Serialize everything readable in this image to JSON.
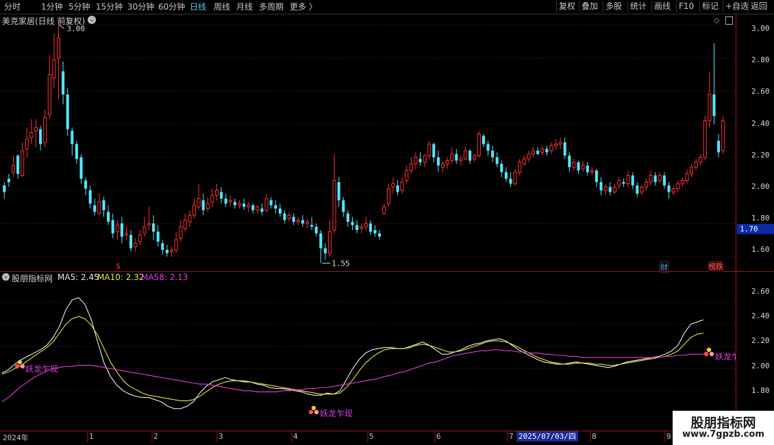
{
  "toolbar": {
    "periods": [
      "分时",
      "1分钟",
      "5分钟",
      "15分钟",
      "30分钟",
      "60分钟",
      "日线",
      "周线",
      "月线",
      "多周期",
      "更多 〉"
    ],
    "active_period": "日线",
    "tools": [
      "复权",
      "叠加",
      "多股",
      "统计",
      "画线",
      "F10",
      "标记",
      "+自选",
      "返回"
    ]
  },
  "main_chart": {
    "title": "美克家居(日线 前复权)",
    "high_label": "3.00",
    "low_label": "1.55",
    "current_price": "1.70",
    "y_ticks": [
      "3.00",
      "2.80",
      "2.60",
      "2.40",
      "2.20",
      "2.00",
      "1.80",
      "1.60"
    ],
    "event_marks": {
      "split": "$",
      "finance": "财",
      "rank": "榜跌"
    }
  },
  "indicator": {
    "name": "股朋指标网",
    "ma5_label": "MA5: 2.45",
    "ma10_label": "MA10: 2.32",
    "ma58_label": "MA58: 2.13",
    "signal_label": "妖龙乍现",
    "signal_label_cut": "妖龙乍",
    "y_ticks": [
      "2.60",
      "2.40",
      "2.20",
      "2.00",
      "1.80"
    ]
  },
  "x_axis": {
    "labels": [
      "2024年",
      "1",
      "2",
      "3",
      "4",
      "5",
      "6",
      "7",
      "8",
      "9"
    ],
    "cursor_date": "2025/07/03/四"
  },
  "watermark": {
    "name": "股朋指标网",
    "url": "www.7gpzb.com"
  },
  "chart_data": {
    "type": "candlestick",
    "title": "美克家居(日线 前复权)",
    "ylim": [
      1.52,
      3.06
    ],
    "y_ticks": [
      3.0,
      2.8,
      2.6,
      2.4,
      2.2,
      2.0,
      1.8,
      1.6
    ],
    "annotations": {
      "high": 3.0,
      "low": 1.55,
      "current": 1.7
    },
    "candles": [
      [
        2.03,
        2.05,
        1.99,
        1.95
      ],
      [
        2.07,
        2.1,
        2.05,
        2.02
      ],
      [
        2.11,
        2.21,
        2.15,
        2.08
      ],
      [
        2.21,
        2.22,
        2.1,
        2.07
      ],
      [
        2.09,
        2.29,
        2.24,
        2.08
      ],
      [
        2.25,
        2.38,
        2.31,
        2.2
      ],
      [
        2.32,
        2.43,
        2.35,
        2.28
      ],
      [
        2.36,
        2.43,
        2.38,
        2.26
      ],
      [
        2.37,
        2.39,
        2.28,
        2.24
      ],
      [
        2.29,
        2.49,
        2.44,
        2.26
      ],
      [
        2.46,
        2.82,
        2.7,
        2.43
      ],
      [
        2.68,
        2.95,
        2.79,
        2.62
      ],
      [
        2.8,
        3.0,
        2.92,
        2.55
      ],
      [
        2.72,
        2.78,
        2.58,
        2.52
      ],
      [
        2.58,
        2.62,
        2.37,
        2.33
      ],
      [
        2.36,
        2.38,
        2.28,
        2.21
      ],
      [
        2.28,
        2.3,
        2.19,
        2.16
      ],
      [
        2.2,
        2.22,
        2.07,
        2.04
      ],
      [
        2.06,
        2.08,
        2.01,
        1.97
      ],
      [
        2.0,
        2.03,
        1.92,
        1.89
      ],
      [
        1.91,
        1.95,
        1.87,
        1.85
      ],
      [
        1.86,
        1.98,
        1.93,
        1.85
      ],
      [
        1.94,
        1.96,
        1.88,
        1.84
      ],
      [
        1.87,
        1.91,
        1.81,
        1.79
      ],
      [
        1.82,
        1.86,
        1.74,
        1.71
      ],
      [
        1.75,
        1.82,
        1.79,
        1.7
      ],
      [
        1.8,
        1.84,
        1.72,
        1.68
      ],
      [
        1.73,
        1.78,
        1.74,
        1.7
      ],
      [
        1.73,
        1.76,
        1.65,
        1.63
      ],
      [
        1.66,
        1.71,
        1.68,
        1.63
      ],
      [
        1.69,
        1.76,
        1.73,
        1.67
      ],
      [
        1.74,
        1.84,
        1.78,
        1.72
      ],
      [
        1.79,
        1.9,
        1.8,
        1.76
      ],
      [
        1.8,
        1.85,
        1.75,
        1.7
      ],
      [
        1.75,
        1.79,
        1.69,
        1.66
      ],
      [
        1.68,
        1.7,
        1.64,
        1.61
      ],
      [
        1.64,
        1.67,
        1.62,
        1.6
      ],
      [
        1.63,
        1.66,
        1.64,
        1.6
      ],
      [
        1.64,
        1.75,
        1.7,
        1.62
      ],
      [
        1.71,
        1.82,
        1.78,
        1.69
      ],
      [
        1.77,
        1.86,
        1.82,
        1.75
      ],
      [
        1.81,
        1.88,
        1.85,
        1.78
      ],
      [
        1.85,
        1.95,
        1.91,
        1.83
      ],
      [
        1.9,
        2.04,
        1.95,
        1.88
      ],
      [
        1.94,
        1.98,
        1.88,
        1.85
      ],
      [
        1.89,
        1.96,
        1.92,
        1.87
      ],
      [
        1.93,
        2.01,
        1.97,
        1.9
      ],
      [
        1.97,
        2.04,
        2.0,
        1.94
      ],
      [
        1.99,
        2.02,
        1.95,
        1.92
      ],
      [
        1.95,
        1.98,
        1.92,
        1.9
      ],
      [
        1.93,
        1.97,
        1.94,
        1.9
      ],
      [
        1.93,
        1.95,
        1.91,
        1.89
      ],
      [
        1.91,
        1.94,
        1.92,
        1.89
      ],
      [
        1.92,
        1.95,
        1.9,
        1.88
      ],
      [
        1.9,
        1.93,
        1.91,
        1.87
      ],
      [
        1.91,
        1.92,
        1.88,
        1.86
      ],
      [
        1.88,
        1.91,
        1.9,
        1.86
      ],
      [
        1.89,
        1.92,
        1.87,
        1.85
      ],
      [
        1.88,
        1.98,
        1.95,
        1.87
      ],
      [
        1.94,
        1.96,
        1.91,
        1.89
      ],
      [
        1.91,
        1.94,
        1.89,
        1.86
      ],
      [
        1.89,
        1.92,
        1.86,
        1.84
      ],
      [
        1.86,
        1.88,
        1.82,
        1.8
      ],
      [
        1.83,
        1.87,
        1.85,
        1.81
      ],
      [
        1.84,
        1.86,
        1.81,
        1.79
      ],
      [
        1.81,
        1.84,
        1.82,
        1.79
      ],
      [
        1.82,
        1.85,
        1.8,
        1.78
      ],
      [
        1.8,
        1.83,
        1.81,
        1.77
      ],
      [
        1.79,
        1.84,
        1.78,
        1.76
      ],
      [
        1.78,
        1.8,
        1.74,
        1.72
      ],
      [
        1.74,
        1.76,
        1.65,
        1.56
      ],
      [
        1.65,
        1.68,
        1.62,
        1.58
      ],
      [
        1.62,
        1.82,
        1.75,
        1.6
      ],
      [
        1.76,
        2.22,
        2.06,
        1.74
      ],
      [
        2.05,
        2.08,
        1.94,
        1.9
      ],
      [
        1.94,
        1.96,
        1.87,
        1.84
      ],
      [
        1.86,
        1.88,
        1.81,
        1.78
      ],
      [
        1.81,
        1.84,
        1.79,
        1.76
      ],
      [
        1.79,
        1.82,
        1.76,
        1.74
      ],
      [
        1.77,
        1.8,
        1.78,
        1.74
      ],
      [
        1.78,
        1.84,
        1.8,
        1.76
      ],
      [
        1.8,
        1.82,
        1.75,
        1.73
      ],
      [
        1.76,
        1.79,
        1.74,
        1.72
      ],
      [
        1.74,
        1.76,
        1.72,
        1.7
      ],
      [
        1.86,
        1.92,
        1.9,
        1.85
      ],
      [
        1.92,
        2.04,
        2.01,
        1.9
      ],
      [
        2.02,
        2.08,
        2.04,
        1.98
      ],
      [
        2.03,
        2.06,
        1.99,
        1.97
      ],
      [
        2.0,
        2.08,
        2.05,
        1.98
      ],
      [
        2.06,
        2.15,
        2.12,
        2.04
      ],
      [
        2.12,
        2.2,
        2.16,
        2.1
      ],
      [
        2.16,
        2.23,
        2.2,
        2.13
      ],
      [
        2.19,
        2.23,
        2.17,
        2.15
      ],
      [
        2.17,
        2.22,
        2.21,
        2.14
      ],
      [
        2.21,
        2.3,
        2.28,
        2.19
      ],
      [
        2.28,
        2.29,
        2.2,
        2.17
      ],
      [
        2.2,
        2.24,
        2.15,
        2.11
      ],
      [
        2.14,
        2.18,
        2.16,
        2.11
      ],
      [
        2.16,
        2.2,
        2.18,
        2.13
      ],
      [
        2.18,
        2.26,
        2.22,
        2.16
      ],
      [
        2.22,
        2.25,
        2.18,
        2.16
      ],
      [
        2.18,
        2.21,
        2.19,
        2.15
      ],
      [
        2.19,
        2.26,
        2.24,
        2.18
      ],
      [
        2.24,
        2.25,
        2.18,
        2.16
      ],
      [
        2.19,
        2.22,
        2.21,
        2.17
      ],
      [
        2.21,
        2.36,
        2.34,
        2.2
      ],
      [
        2.33,
        2.34,
        2.28,
        2.26
      ],
      [
        2.28,
        2.3,
        2.24,
        2.21
      ],
      [
        2.24,
        2.27,
        2.2,
        2.17
      ],
      [
        2.2,
        2.23,
        2.16,
        2.14
      ],
      [
        2.16,
        2.18,
        2.11,
        2.08
      ],
      [
        2.11,
        2.14,
        2.07,
        2.05
      ],
      [
        2.07,
        2.11,
        2.04,
        2.02
      ],
      [
        2.04,
        2.13,
        2.11,
        2.03
      ],
      [
        2.11,
        2.19,
        2.17,
        2.09
      ],
      [
        2.16,
        2.21,
        2.19,
        2.15
      ],
      [
        2.19,
        2.24,
        2.22,
        2.17
      ],
      [
        2.22,
        2.26,
        2.24,
        2.2
      ],
      [
        2.24,
        2.26,
        2.22,
        2.21
      ],
      [
        2.23,
        2.27,
        2.25,
        2.21
      ],
      [
        2.25,
        2.27,
        2.23,
        2.21
      ],
      [
        2.24,
        2.29,
        2.27,
        2.22
      ],
      [
        2.27,
        2.31,
        2.28,
        2.25
      ],
      [
        2.28,
        2.32,
        2.29,
        2.25
      ],
      [
        2.29,
        2.32,
        2.21,
        2.19
      ],
      [
        2.21,
        2.23,
        2.14,
        2.11
      ],
      [
        2.14,
        2.19,
        2.17,
        2.12
      ],
      [
        2.17,
        2.18,
        2.12,
        2.1
      ],
      [
        2.13,
        2.18,
        2.15,
        2.11
      ],
      [
        2.15,
        2.17,
        2.11,
        2.09
      ],
      [
        2.11,
        2.14,
        2.12,
        2.09
      ],
      [
        2.12,
        2.13,
        2.05,
        2.02
      ],
      [
        2.05,
        2.08,
        2.0,
        1.97
      ],
      [
        2.0,
        2.04,
        2.02,
        1.97
      ],
      [
        2.02,
        2.05,
        1.99,
        1.97
      ],
      [
        1.99,
        2.04,
        2.02,
        1.98
      ],
      [
        2.03,
        2.08,
        2.06,
        2.01
      ],
      [
        2.05,
        2.07,
        2.04,
        2.02
      ],
      [
        2.04,
        2.12,
        2.09,
        2.02
      ],
      [
        2.09,
        2.11,
        2.03,
        2.01
      ],
      [
        2.03,
        2.05,
        1.98,
        1.96
      ],
      [
        1.99,
        2.03,
        2.02,
        1.97
      ],
      [
        2.02,
        2.07,
        2.05,
        2.0
      ],
      [
        2.05,
        2.12,
        2.09,
        2.03
      ],
      [
        2.09,
        2.11,
        2.05,
        2.03
      ],
      [
        2.06,
        2.11,
        2.09,
        2.04
      ],
      [
        2.09,
        2.11,
        2.03,
        2.01
      ],
      [
        2.03,
        2.05,
        1.99,
        1.95
      ],
      [
        1.99,
        2.03,
        2.01,
        1.97
      ],
      [
        2.01,
        2.06,
        2.04,
        1.99
      ],
      [
        2.04,
        2.08,
        2.06,
        2.02
      ],
      [
        2.06,
        2.13,
        2.1,
        2.04
      ],
      [
        2.1,
        2.16,
        2.14,
        2.08
      ],
      [
        2.14,
        2.19,
        2.17,
        2.12
      ],
      [
        2.17,
        2.22,
        2.2,
        2.15
      ],
      [
        2.2,
        2.45,
        2.42,
        2.18
      ],
      [
        2.42,
        2.72,
        2.58,
        2.38
      ],
      [
        2.58,
        2.89,
        2.45,
        2.4
      ],
      [
        2.3,
        2.34,
        2.23,
        2.2
      ],
      [
        2.24,
        2.45,
        2.42,
        2.22
      ]
    ],
    "indicator": {
      "ylim": [
        1.62,
        2.78
      ],
      "y_ticks": [
        2.6,
        2.4,
        2.2,
        2.0,
        1.8
      ],
      "series": [
        {
          "name": "MA5",
          "color": "#f0f0f0",
          "values": [
            1.96,
            1.99,
            2.04,
            2.08,
            2.11,
            2.14,
            2.17,
            2.21,
            2.28,
            2.38,
            2.53,
            2.62,
            2.64,
            2.58,
            2.44,
            2.24,
            2.05,
            1.93,
            1.85,
            1.8,
            1.77,
            1.75,
            1.74,
            1.74,
            1.72,
            1.7,
            1.66,
            1.64,
            1.64,
            1.66,
            1.7,
            1.78,
            1.84,
            1.88,
            1.9,
            1.92,
            1.9,
            1.89,
            1.88,
            1.88,
            1.86,
            1.85,
            1.83,
            1.82,
            1.82,
            1.81,
            1.8,
            1.79,
            1.77,
            1.76,
            1.76,
            1.78,
            1.77,
            1.8,
            1.9,
            2.0,
            2.08,
            2.14,
            2.17,
            2.18,
            2.19,
            2.19,
            2.18,
            2.18,
            2.2,
            2.22,
            2.24,
            2.21,
            2.17,
            2.13,
            2.13,
            2.15,
            2.17,
            2.2,
            2.22,
            2.23,
            2.25,
            2.26,
            2.27,
            2.25,
            2.21,
            2.17,
            2.14,
            2.11,
            2.08,
            2.06,
            2.05,
            2.04,
            2.04,
            2.05,
            2.06,
            2.05,
            2.04,
            2.03,
            2.02,
            2.01,
            2.02,
            2.04,
            2.06,
            2.07,
            2.08,
            2.09,
            2.1,
            2.11,
            2.13,
            2.16,
            2.21,
            2.32,
            2.4,
            2.42,
            2.44
          ]
        },
        {
          "name": "MA10",
          "color": "#e8e840",
          "values": [
            1.95,
            1.97,
            2.0,
            2.03,
            2.07,
            2.11,
            2.15,
            2.19,
            2.24,
            2.32,
            2.4,
            2.45,
            2.47,
            2.45,
            2.39,
            2.3,
            2.18,
            2.06,
            1.97,
            1.89,
            1.84,
            1.81,
            1.78,
            1.76,
            1.75,
            1.74,
            1.73,
            1.72,
            1.71,
            1.71,
            1.72,
            1.75,
            1.79,
            1.83,
            1.86,
            1.88,
            1.89,
            1.89,
            1.89,
            1.88,
            1.87,
            1.86,
            1.85,
            1.84,
            1.83,
            1.82,
            1.81,
            1.8,
            1.79,
            1.78,
            1.77,
            1.77,
            1.77,
            1.78,
            1.83,
            1.9,
            1.98,
            2.05,
            2.1,
            2.14,
            2.17,
            2.18,
            2.18,
            2.18,
            2.19,
            2.21,
            2.22,
            2.21,
            2.19,
            2.17,
            2.15,
            2.15,
            2.16,
            2.18,
            2.2,
            2.22,
            2.24,
            2.25,
            2.25,
            2.24,
            2.22,
            2.19,
            2.16,
            2.13,
            2.1,
            2.08,
            2.06,
            2.05,
            2.04,
            2.04,
            2.05,
            2.05,
            2.05,
            2.04,
            2.04,
            2.03,
            2.03,
            2.04,
            2.05,
            2.06,
            2.07,
            2.08,
            2.09,
            2.1,
            2.11,
            2.13,
            2.16,
            2.22,
            2.28,
            2.31,
            2.32
          ]
        },
        {
          "name": "MA58",
          "color": "#e040e0",
          "values": [
            1.7,
            1.74,
            1.79,
            1.84,
            1.88,
            1.92,
            1.95,
            1.98,
            2.0,
            2.01,
            2.02,
            2.02,
            2.03,
            2.03,
            2.03,
            2.02,
            2.01,
            2.0,
            1.99,
            1.98,
            1.97,
            1.96,
            1.95,
            1.94,
            1.93,
            1.92,
            1.91,
            1.9,
            1.89,
            1.88,
            1.87,
            1.86,
            1.86,
            1.85,
            1.84,
            1.83,
            1.82,
            1.81,
            1.8,
            1.8,
            1.79,
            1.79,
            1.79,
            1.79,
            1.8,
            1.8,
            1.81,
            1.81,
            1.82,
            1.82,
            1.83,
            1.83,
            1.84,
            1.85,
            1.86,
            1.87,
            1.88,
            1.89,
            1.9,
            1.91,
            1.93,
            1.94,
            1.96,
            1.97,
            1.99,
            2.01,
            2.03,
            2.05,
            2.06,
            2.08,
            2.1,
            2.12,
            2.13,
            2.14,
            2.15,
            2.16,
            2.16,
            2.17,
            2.17,
            2.16,
            2.16,
            2.15,
            2.15,
            2.14,
            2.14,
            2.13,
            2.13,
            2.12,
            2.12,
            2.11,
            2.11,
            2.1,
            2.1,
            2.1,
            2.1,
            2.1,
            2.1,
            2.1,
            2.1,
            2.1,
            2.1,
            2.1,
            2.1,
            2.1,
            2.11,
            2.11,
            2.12,
            2.12,
            2.13,
            2.13,
            2.13
          ]
        }
      ]
    }
  }
}
